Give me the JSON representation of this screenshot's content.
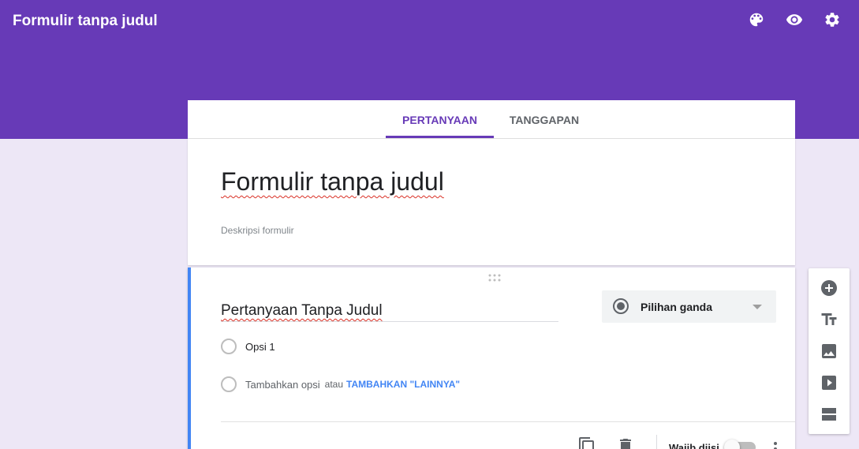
{
  "app": {
    "title": "Formulir tanpa judul"
  },
  "header_icons": [
    "palette-icon",
    "eye-icon",
    "gear-icon"
  ],
  "tabs": [
    {
      "label": "PERTANYAAN",
      "active": true
    },
    {
      "label": "TANGGAPAN",
      "active": false
    }
  ],
  "form": {
    "title": "Formulir tanpa judul",
    "description_placeholder": "Deskripsi formulir"
  },
  "question": {
    "title": "Pertanyaan Tanpa Judul",
    "type_label": "Pilihan ganda",
    "options": [
      {
        "label": "Opsi 1"
      }
    ],
    "add_option_label": "Tambahkan opsi",
    "or_label": "atau",
    "add_other_label": "TAMBAHKAN \"LAINNYA\"",
    "required_label": "Wajib diisi",
    "required": false
  },
  "side_toolbar": [
    "add-question-icon",
    "add-title-icon",
    "add-image-icon",
    "add-video-icon",
    "add-section-icon"
  ],
  "colors": {
    "header": "#673ab7",
    "background": "#ede7f6",
    "active_tab": "#673ab7",
    "question_accent": "#4285f4",
    "link": "#4285f4"
  }
}
